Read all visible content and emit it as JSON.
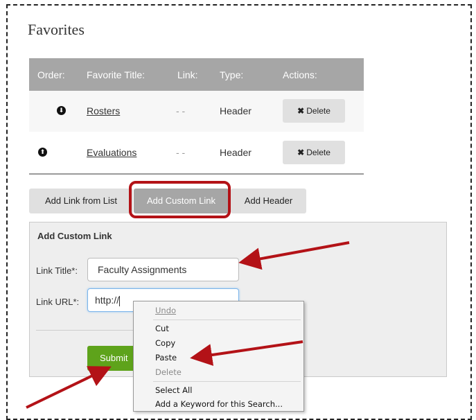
{
  "page": {
    "title": "Favorites"
  },
  "table": {
    "headers": {
      "order": "Order:",
      "title": "Favorite Title:",
      "link": "Link:",
      "type": "Type:",
      "actions": "Actions:"
    },
    "rows": [
      {
        "title": "Rosters",
        "link": "- -",
        "type": "Header",
        "order_icon": "arrow-down-circle-icon",
        "order_glyph": "⬇",
        "delete": "Delete",
        "delete_glyph": "✖"
      },
      {
        "title": "Evaluations",
        "link": "- -",
        "type": "Header",
        "order_icon": "arrow-up-circle-icon",
        "order_glyph": "⬆",
        "delete": "Delete",
        "delete_glyph": "✖"
      }
    ]
  },
  "tabs": [
    {
      "label": "Add Link from List",
      "active": false
    },
    {
      "label": "Add Custom Link",
      "active": true
    },
    {
      "label": "Add Header",
      "active": false
    }
  ],
  "form": {
    "heading": "Add Custom Link",
    "title_label": "Link Title*:",
    "title_value": "Faculty Assignments",
    "url_label": "Link URL*:",
    "url_value": "http://",
    "submit_label": "Submit"
  },
  "context_menu": {
    "undo": "Undo",
    "cut": "Cut",
    "copy": "Copy",
    "paste": "Paste",
    "delete": "Delete",
    "select_all": "Select All",
    "add_keyword": "Add a Keyword for this Search..."
  },
  "colors": {
    "header_bg": "#a6a6a6",
    "highlight": "#b31217",
    "submit": "#5ea31b",
    "annotation_arrow": "#b31217"
  }
}
